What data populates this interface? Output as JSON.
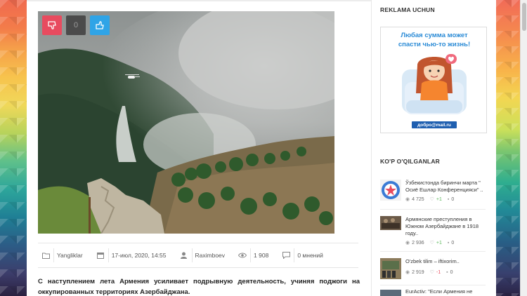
{
  "rating": {
    "count": "0"
  },
  "meta": {
    "category": "Yangliklar",
    "date": "17-июл, 2020, 14:55",
    "author": "Raximboev",
    "views": "1 908",
    "comments": "0 мнений"
  },
  "article": {
    "lead": "С наступлением лета Армения усиливает подрывную деятельность, учиняя поджоги на оккупированных территориях Азербайджана."
  },
  "sidebar": {
    "ad_heading": "REKLAMA UCHUN",
    "ad_line1": "Любая сумма может",
    "ad_line2": "спасти чью-то жизнь!",
    "ad_logo": "добро@mail.ru",
    "popular_heading": "KO'P O'QILGANLAR",
    "popular": [
      {
        "title": "Ўзбекистонда биринчи марта \" Осиё Ешлар Конференцияси\" ..",
        "views": "4 725",
        "plus": "+1",
        "comments": "0"
      },
      {
        "title": "Армянские преступления в Южном Азербайджане в 1918 году..",
        "views": "2 936",
        "plus": "+1",
        "comments": "0"
      },
      {
        "title": "O'zbek tilim – iftixorim..",
        "views": "2 919",
        "plus": "-1",
        "comments": "0"
      },
      {
        "title": "EurActiv: \"Если Армения не"
      }
    ]
  },
  "colors": {
    "dislike": "#e84b5f",
    "like": "#2fa4e7",
    "plus": "#5cb85c",
    "minus": "#e84b5f"
  },
  "icons": [
    "thumbs-down-icon",
    "thumbs-up-icon",
    "folder-icon",
    "calendar-icon",
    "user-icon",
    "eye-icon",
    "comment-icon",
    "heart-icon"
  ]
}
